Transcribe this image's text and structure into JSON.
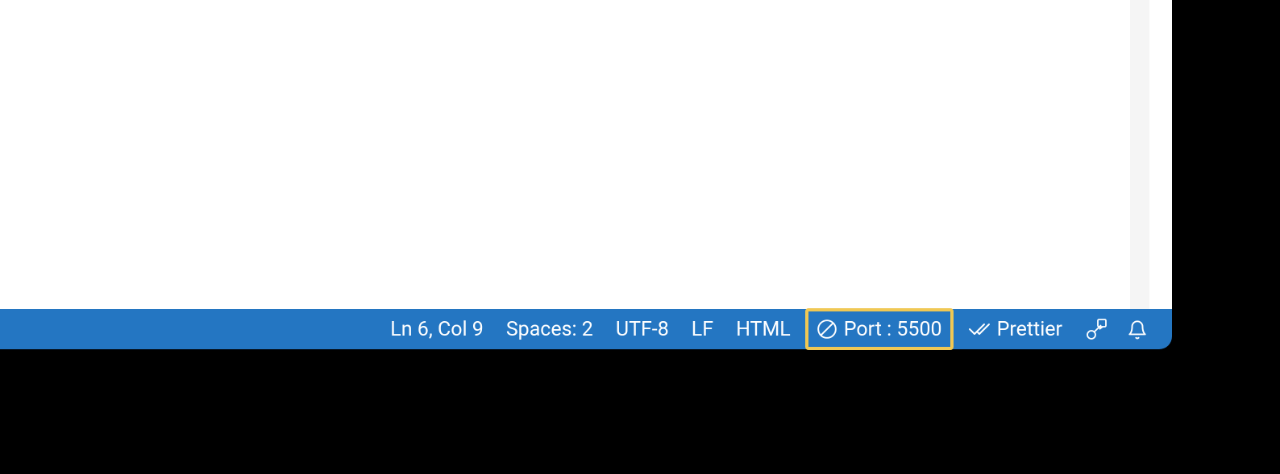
{
  "statusbar": {
    "cursor_position": "Ln 6, Col 9",
    "indentation": "Spaces: 2",
    "encoding": "UTF-8",
    "eol": "LF",
    "language": "HTML",
    "live_server": "Port : 5500",
    "prettier": "Prettier"
  }
}
